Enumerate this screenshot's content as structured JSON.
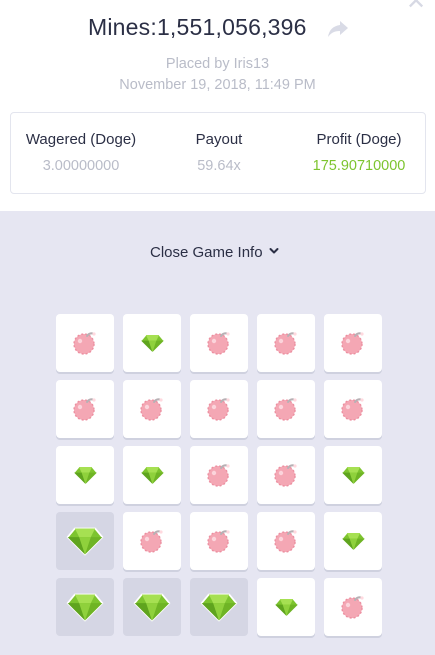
{
  "header": {
    "title": "Mines:1,551,056,396",
    "placed_by": "Placed by Iris13",
    "date": "November 19, 2018, 11:49 PM",
    "close_glyph": "✕",
    "share_icon": "share-icon"
  },
  "stats": {
    "wagered_label": "Wagered (Doge)",
    "wagered_value": "3.00000000",
    "payout_label": "Payout",
    "payout_value": "59.64x",
    "profit_label": "Profit (Doge)",
    "profit_value": "175.90710000"
  },
  "toggle": {
    "label": "Close Game Info",
    "icon": "chevron-down-icon"
  },
  "colors": {
    "gem": "#7dc42f",
    "mine": "#f4a7b4",
    "revealed_tile": "#d5d6e4",
    "panel_bg": "#e6e6f2"
  },
  "board": [
    [
      "mine",
      "gem",
      "mine",
      "mine",
      "mine"
    ],
    [
      "mine",
      "mine",
      "mine",
      "mine",
      "mine"
    ],
    [
      "gem",
      "gem",
      "mine",
      "mine",
      "gem"
    ],
    [
      "gem-picked",
      "mine",
      "mine",
      "mine",
      "gem"
    ],
    [
      "gem-picked",
      "gem-picked",
      "gem-picked",
      "gem",
      "mine"
    ]
  ]
}
